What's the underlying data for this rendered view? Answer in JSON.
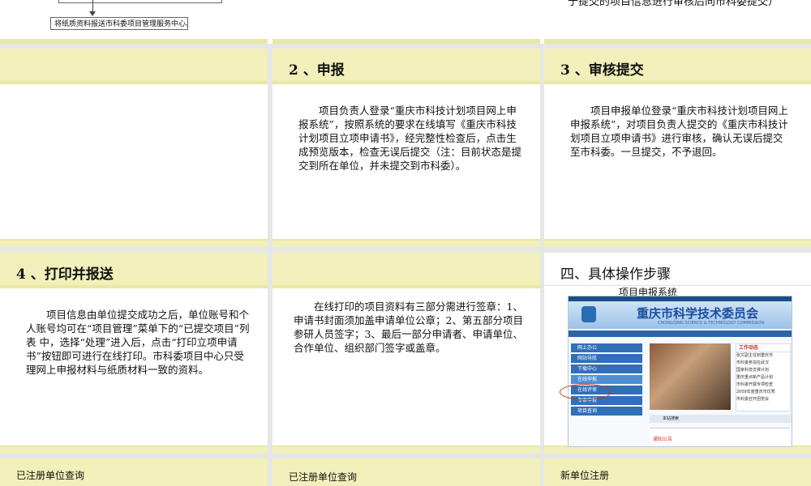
{
  "top_strip": {
    "flow_box_text": "将纸质资料报送市科委项目管理服务中心。",
    "continued_text": "于提交的项目信息进行审核后向市科委提交）"
  },
  "slides": [
    {
      "header": "",
      "body": ""
    },
    {
      "header": "2 、申报",
      "body": "项目负责人登录“重庆市科技计划项目网上申报系统”，按照系统的要求在线填写《重庆市科技计划项目立项申请书》，经完整性检查后，点击生成预览版本，检查无误后提交（注：目前状态是提交到所在单位，并未提交到市科委）。"
    },
    {
      "header": "3 、审核提交",
      "body": "项目申报单位登录“重庆市科技计划项目网上申报系统”，对项目负责人提交的《重庆市科技计划项目立项申请书》进行审核，确认无误后提交至市科委。一旦提交，不予退回。"
    },
    {
      "header": "4 、打印并报送",
      "body": "项目信息由单位提交成功之后，单位账号和个人账号均可在“项目管理”菜单下的“已提交项目”列表 中，选择“处理”进入后，点击“打印立项申请书”按钮即可进行在线打印。市科委项目中心只受理网上申报材料与纸质材料一致的资料。"
    },
    {
      "header": "",
      "body": "在线打印的项目资料有三部分需进行签章：1、申请书封面须加盖申请单位公章；2、第五部分项目参研人员签字；3、最后一部分申请者、申请单位、合作单位、组织部门签字或盖章。"
    },
    {
      "header": "四、具体操作步骤",
      "caption": "项目申报系统"
    }
  ],
  "screenshot": {
    "site_title": "重庆市科学技术委员会",
    "site_title_en": "CHONGQING SCIENCE & TECHNOLOGY COMMISSION",
    "side_menu": [
      "网上办公",
      "网站导航",
      "下载中心",
      "在线申报",
      "在线评审",
      "专家申报",
      "项目查询"
    ],
    "news_header": "工作动态",
    "news_items": [
      "张文副主任到重庆市",
      "市科委参加在武汉",
      "国家科技支撑计划",
      "重庆重点新产品计划",
      "市科委开展专项检查",
      "2009年度重庆市优秀",
      "市科委召开团党会"
    ],
    "search_label": "本站搜索",
    "news_bar": "通知公告"
  },
  "bottom_labels": [
    "已注册单位查询",
    "已注册单位查询",
    "新单位注册"
  ]
}
